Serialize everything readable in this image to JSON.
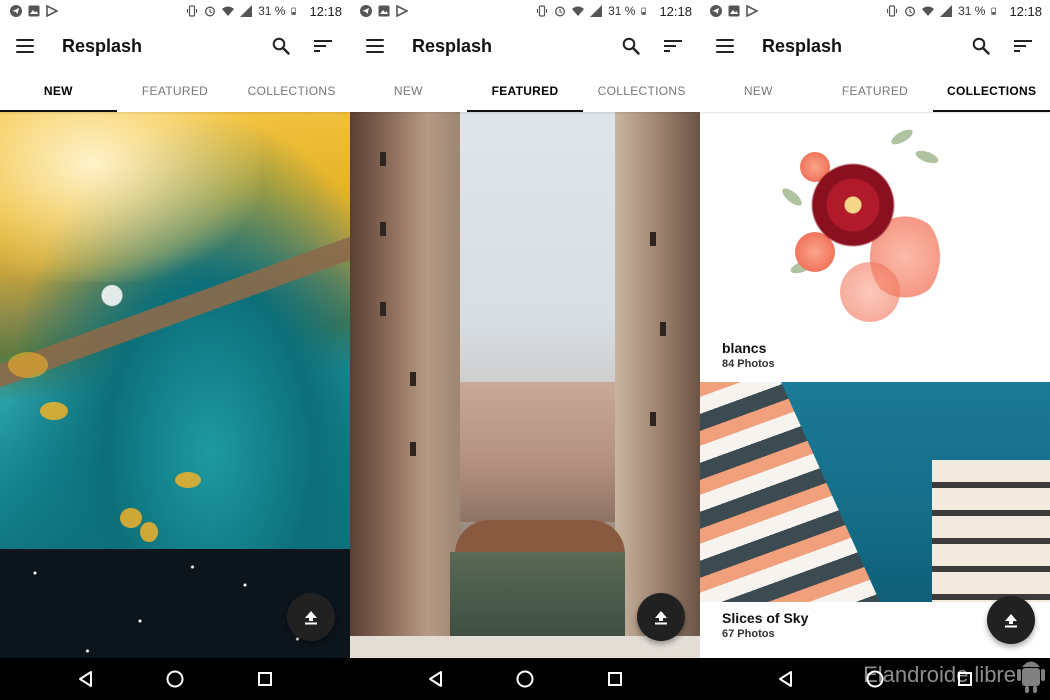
{
  "status": {
    "battery": "31 %",
    "time": "12:18"
  },
  "app": {
    "title": "Resplash"
  },
  "tabs": [
    "NEW",
    "FEATURED",
    "COLLECTIONS"
  ],
  "screens": [
    {
      "active_tab": 0
    },
    {
      "active_tab": 1
    },
    {
      "active_tab": 2
    }
  ],
  "collections": [
    {
      "title": "blancs",
      "count": "84 Photos"
    },
    {
      "title": "Slices of Sky",
      "count": "67 Photos"
    }
  ],
  "watermark": "Elandroide libre",
  "icons": {
    "menu": "hamburger-icon",
    "search": "search-icon",
    "sort": "sort-icon",
    "upload": "upload-icon",
    "back": "back-triangle-icon",
    "home": "home-circle-icon",
    "recents": "recents-square-icon"
  },
  "colors": {
    "fab": "#212121",
    "tab_indicator": "#111111",
    "nav_bar": "#000000"
  }
}
